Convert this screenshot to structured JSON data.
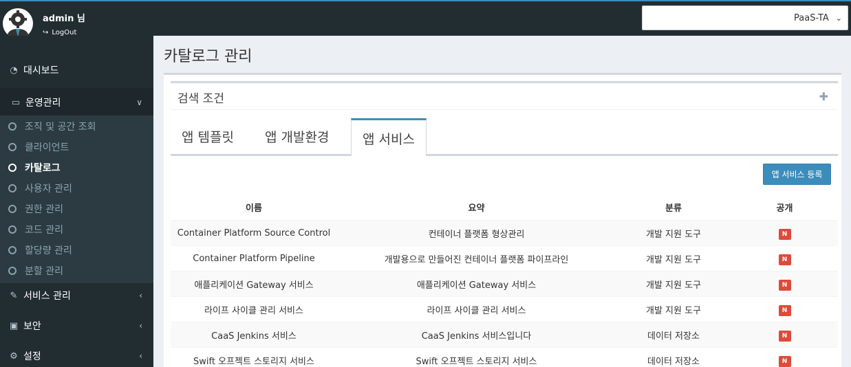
{
  "header": {
    "username": "admin 님",
    "logout_label": "LogOut",
    "org_select_value": "PaaS-TA"
  },
  "sidebar": {
    "dashboard": "대시보드",
    "operations": "운영관리",
    "operations_items": [
      {
        "label": "조직 및 공간 조회"
      },
      {
        "label": "클라이언트"
      },
      {
        "label": "카탈로그"
      },
      {
        "label": "사용자 관리"
      },
      {
        "label": "권한 관리"
      },
      {
        "label": "코드 관리"
      },
      {
        "label": "할당량 관리"
      },
      {
        "label": "분할 관리"
      }
    ],
    "service_mgmt": "서비스 관리",
    "security": "보안",
    "settings": "설정"
  },
  "main": {
    "page_title": "카탈로그 관리",
    "search_title": "검색 조건",
    "tabs": [
      {
        "label": "앱 템플릿"
      },
      {
        "label": "앱 개발환경"
      },
      {
        "label": "앱 서비스"
      }
    ],
    "register_button": "앱 서비스 등록",
    "table": {
      "headers": [
        "이름",
        "요약",
        "분류",
        "공개"
      ],
      "rows": [
        {
          "name": "Container Platform Source Control",
          "summary": "컨테이너 플랫폼 형상관리",
          "category": "개발 지원 도구",
          "public": "N"
        },
        {
          "name": "Container Platform Pipeline",
          "summary": "개발용으로 만들어진 컨테이너 플랫폼 파이프라인",
          "category": "개발 지원 도구",
          "public": "N"
        },
        {
          "name": "애플리케이션 Gateway 서비스",
          "summary": "애플리케이션 Gateway 서비스",
          "category": "개발 지원 도구",
          "public": "N"
        },
        {
          "name": "라이프 사이클 관리 서비스",
          "summary": "라이프 사이클 관리 서비스",
          "category": "개발 지원 도구",
          "public": "N"
        },
        {
          "name": "CaaS Jenkins 서비스",
          "summary": "CaaS Jenkins 서비스입니다",
          "category": "데이터 저장소",
          "public": "N"
        },
        {
          "name": "Swift 오프젝트 스토리지 서비스",
          "summary": "Swift 오프젝트 스토리지 서비스",
          "category": "데이터 저장소",
          "public": "N"
        }
      ]
    }
  }
}
